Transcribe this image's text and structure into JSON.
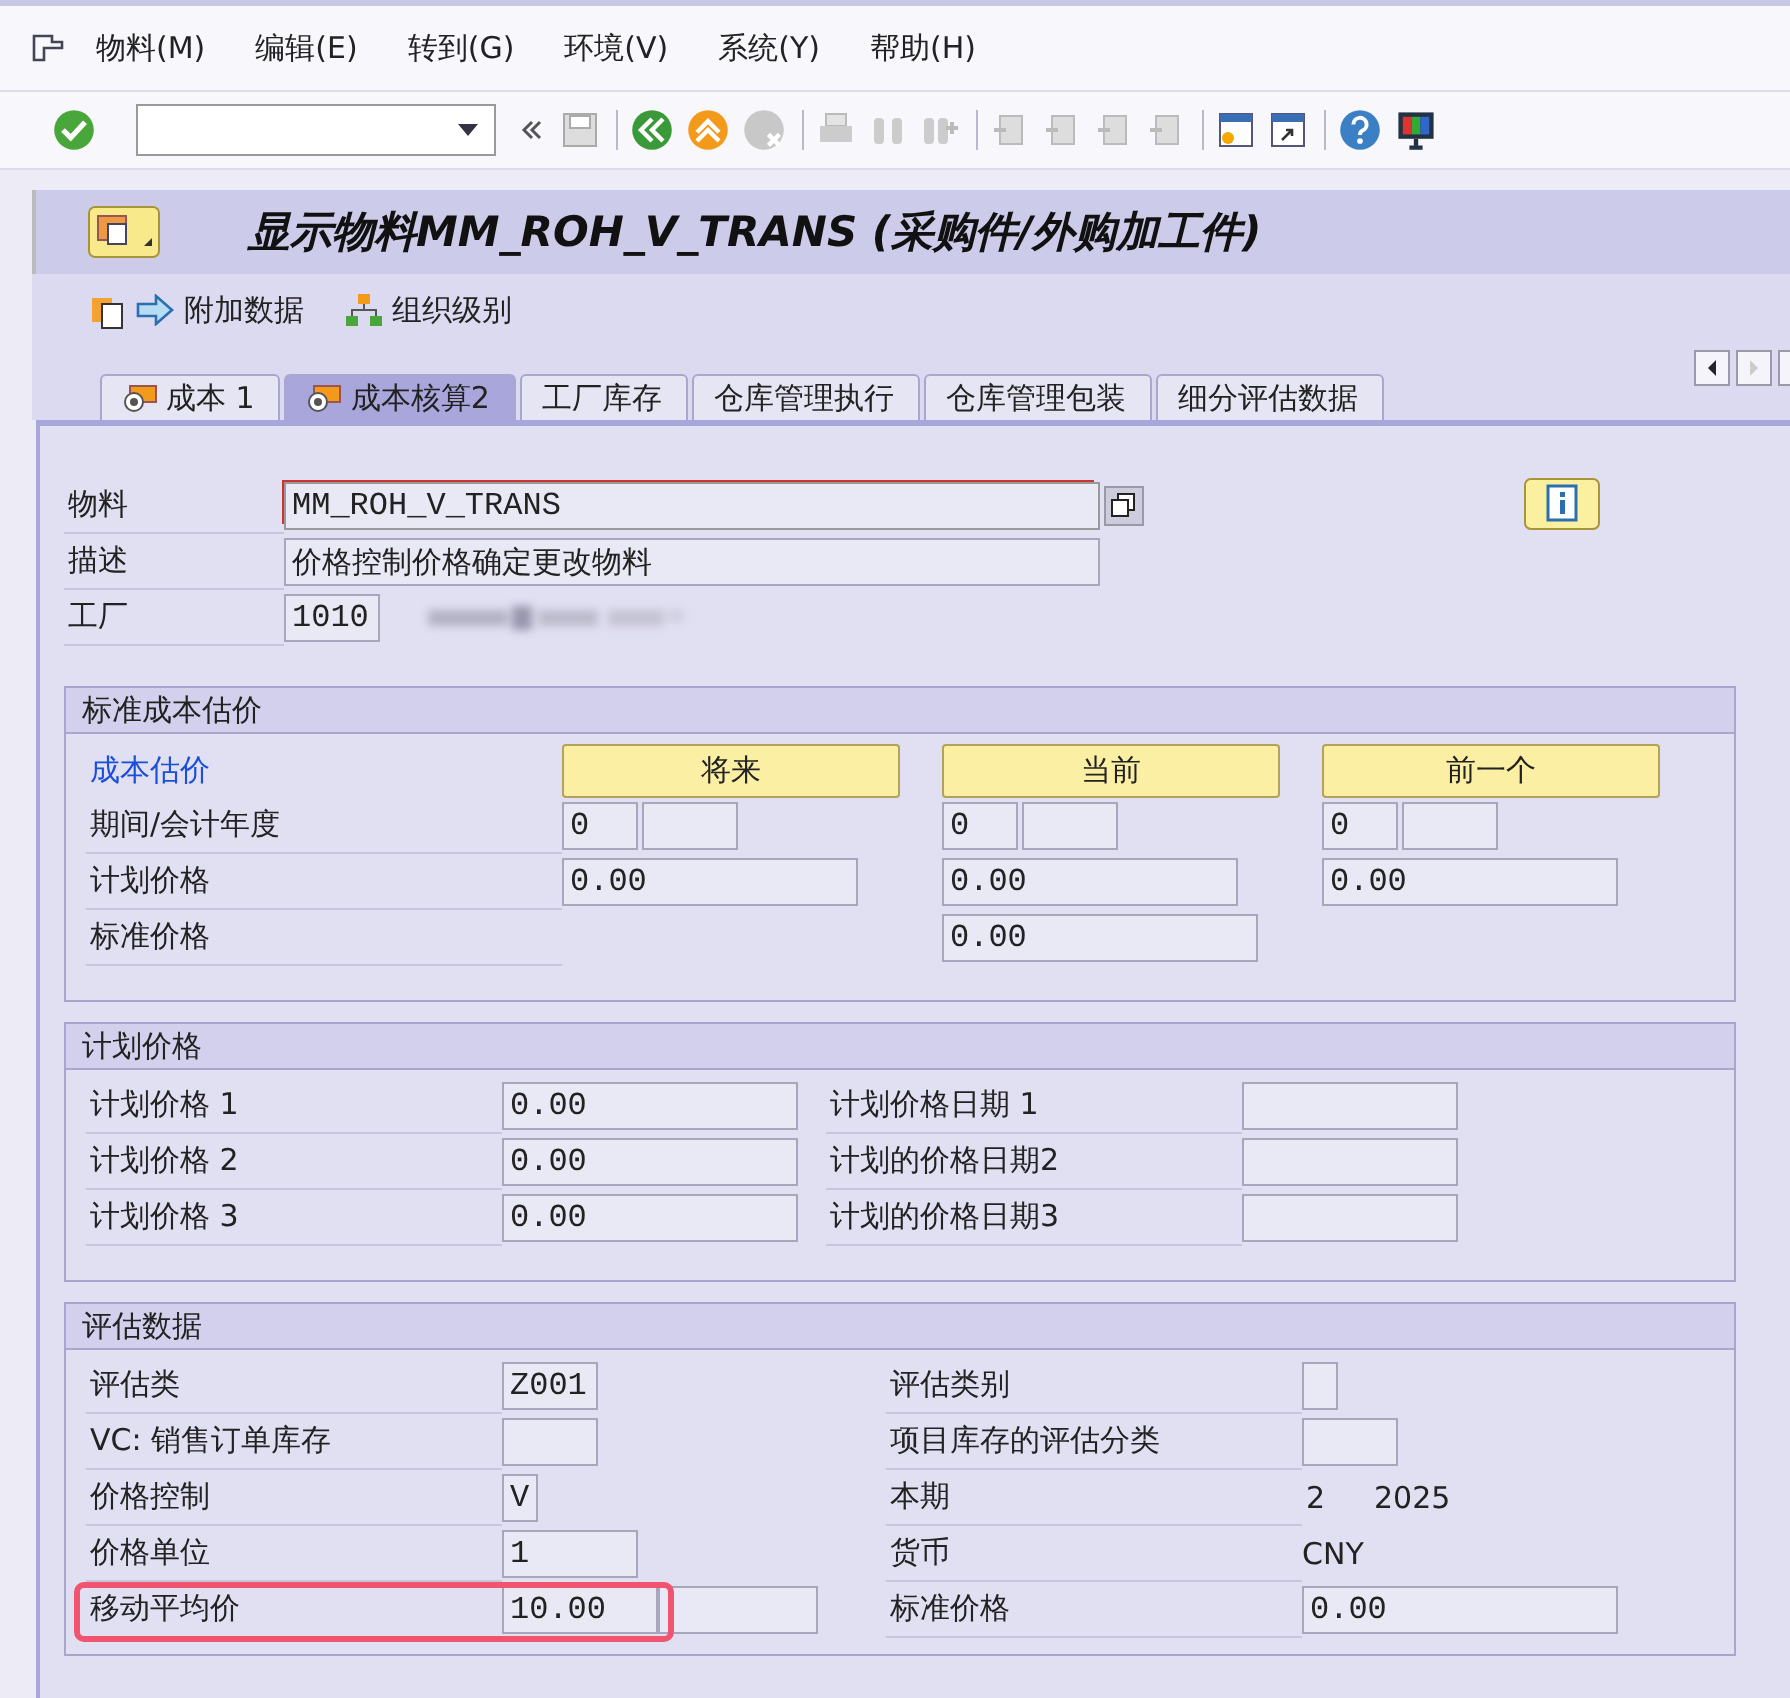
{
  "menu": [
    "物料(M)",
    "编辑(E)",
    "转到(G)",
    "环境(V)",
    "系统(Y)",
    "帮助(H)"
  ],
  "title": "显示物料MM_ROH_V_TRANS (采购件/外购加工件)",
  "app_toolbar": [
    {
      "label": "附加数据",
      "kind": "arrow"
    },
    {
      "label": "组织级别",
      "kind": "org"
    }
  ],
  "tabs": [
    {
      "label": "成本 1",
      "selected": false,
      "icon": true
    },
    {
      "label": "成本核算2",
      "selected": true,
      "icon": true
    },
    {
      "label": "工厂库存",
      "selected": false,
      "icon": false
    },
    {
      "label": "仓库管理执行",
      "selected": false,
      "icon": false
    },
    {
      "label": "仓库管理包装",
      "selected": false,
      "icon": false
    },
    {
      "label": "细分评估数据",
      "selected": false,
      "icon": false
    }
  ],
  "header": {
    "material_label": "物料",
    "material": "MM_ROH_V_TRANS",
    "description_label": "描述",
    "description": "价格控制价格确定更改物料",
    "plant_label": "工厂",
    "plant": "1010"
  },
  "standard_cost_estimate": {
    "title": "标准成本估价",
    "link": "成本估价",
    "buttons": [
      "将来",
      "当前",
      "前一个"
    ],
    "rows": [
      {
        "label": "期间/会计年度",
        "cells": [
          {
            "kind": "period",
            "value": "0"
          },
          {
            "kind": "period",
            "value": "0"
          },
          {
            "kind": "period",
            "value": "0"
          }
        ]
      },
      {
        "label": "计划价格",
        "cells": [
          {
            "kind": "price",
            "value": "0.00"
          },
          {
            "kind": "price",
            "value": "0.00"
          },
          {
            "kind": "price",
            "value": "0.00"
          }
        ]
      },
      {
        "label": "标准价格",
        "cells": [
          {
            "kind": "none"
          },
          {
            "kind": "wide",
            "value": "0.00"
          },
          {
            "kind": "none"
          }
        ]
      }
    ]
  },
  "planned_prices": {
    "title": "计划价格",
    "rows": [
      {
        "label": "计划价格 1",
        "value": "0.00",
        "date_label": "计划价格日期 1"
      },
      {
        "label": "计划价格 2",
        "value": "0.00",
        "date_label": "计划的价格日期2"
      },
      {
        "label": "计划价格 3",
        "value": "0.00",
        "date_label": "计划的价格日期3"
      }
    ]
  },
  "valuation": {
    "title": "评估数据",
    "rows": [
      {
        "left": {
          "label": "评估类",
          "kind": "code",
          "value": "Z001",
          "highlighted": false
        },
        "right": {
          "label": "评估类别",
          "kind": "flag"
        }
      },
      {
        "left": {
          "label": "VC: 销售订单库存",
          "kind": "code",
          "highlighted": false
        },
        "right": {
          "label": "项目库存的评估分类",
          "kind": "code"
        }
      },
      {
        "left": {
          "label": "价格控制",
          "kind": "flag",
          "value": "V",
          "highlighted": false
        },
        "right": {
          "label": "本期",
          "kind": "period",
          "value": "2",
          "year": "2025"
        }
      },
      {
        "left": {
          "label": "价格单位",
          "kind": "unit",
          "value": "1",
          "highlighted": false
        },
        "right": {
          "label": "货币",
          "kind": "text",
          "value": "CNY"
        }
      },
      {
        "left": {
          "label": "移动平均价",
          "kind": "amount",
          "value": "10.00",
          "highlighted": true
        },
        "right": {
          "label": "标准价格",
          "kind": "wide",
          "value": "0.00"
        }
      }
    ]
  }
}
